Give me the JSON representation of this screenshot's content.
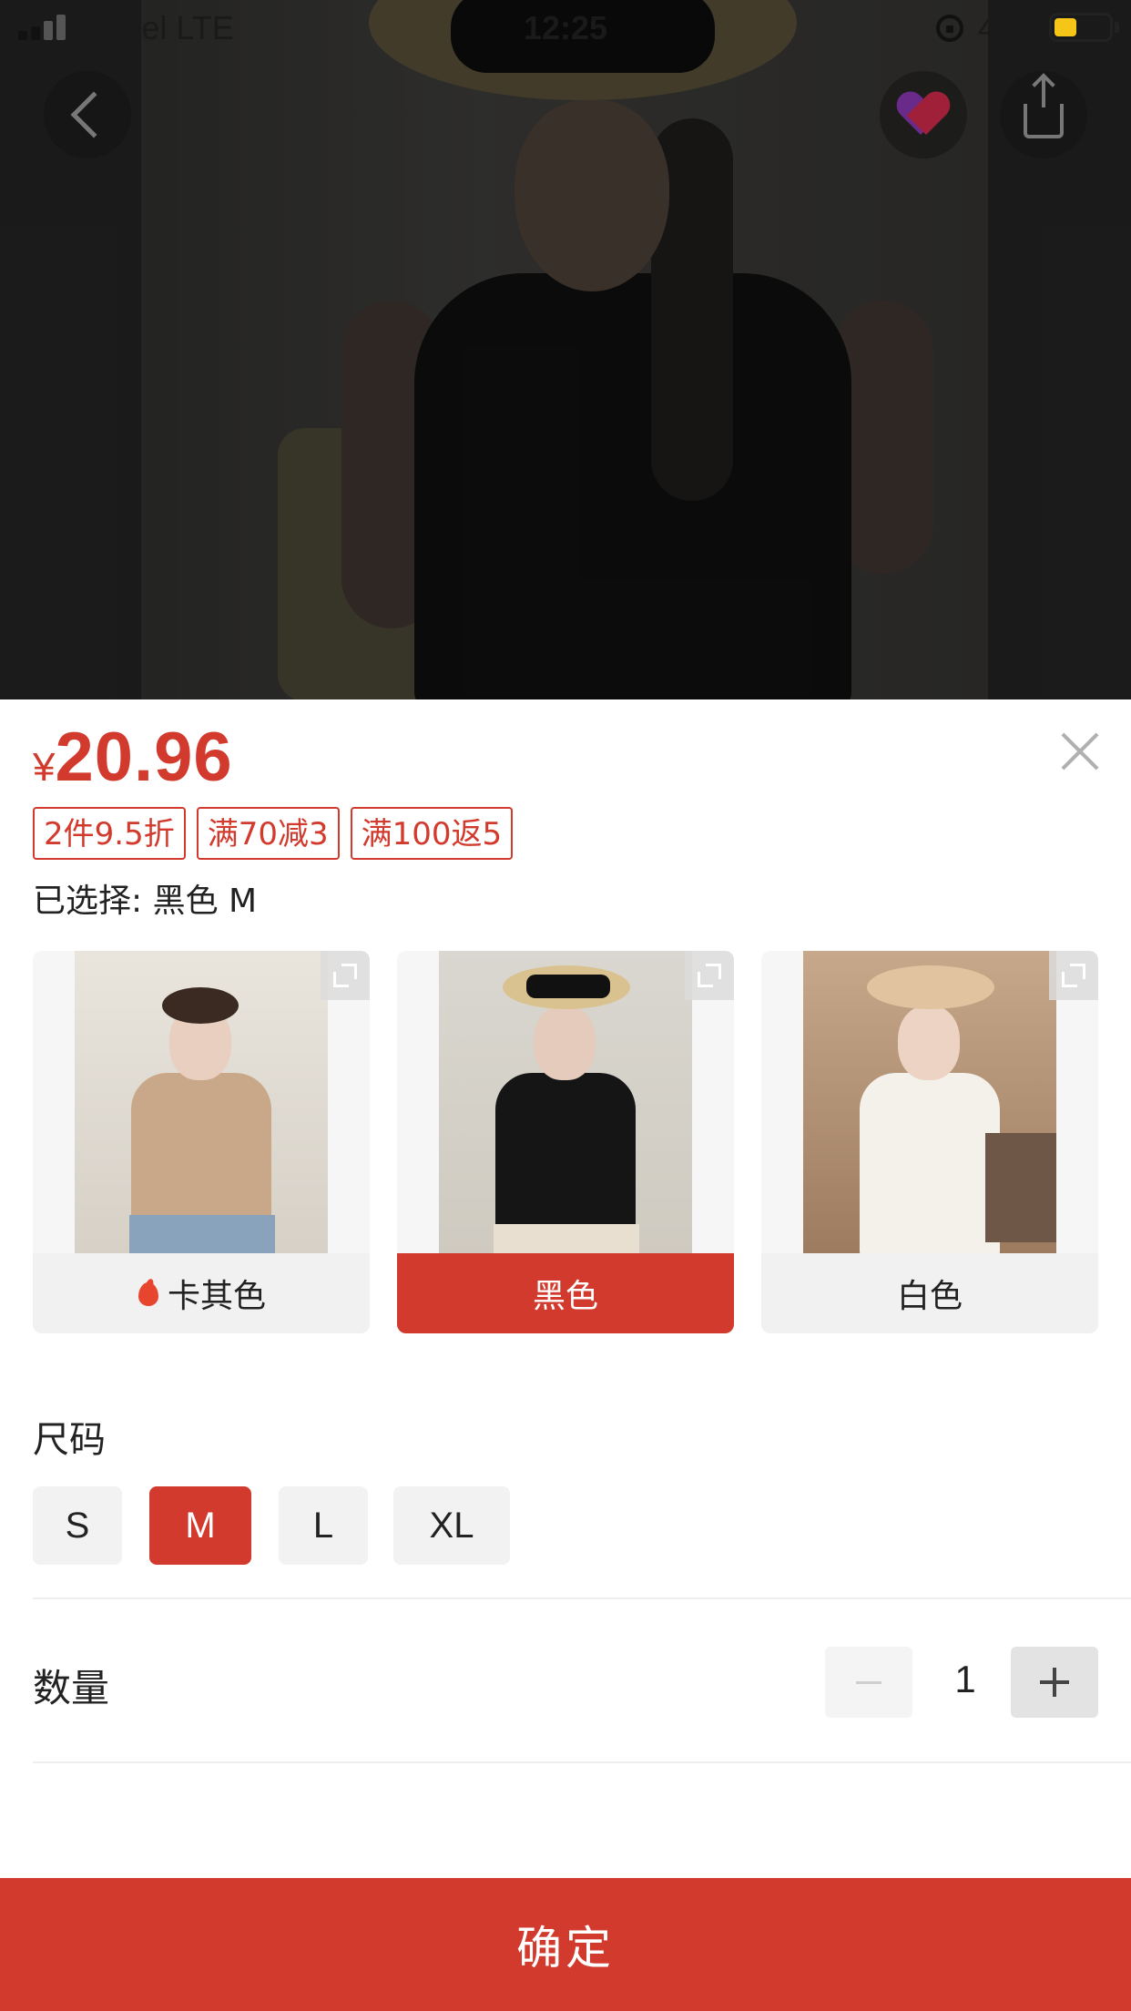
{
  "status_bar": {
    "carrier": "Viettel  LTE",
    "time": "12:25",
    "battery": "41%",
    "battery_level": 0.41
  },
  "product": {
    "currency_symbol": "¥",
    "price": "20.96",
    "promo_tags": [
      "2件9.5折",
      "满70减3",
      "满100返5"
    ],
    "selected_text": "已选择: 黑色 M"
  },
  "colors": [
    {
      "label": "卡其色",
      "hot": true,
      "active": false,
      "icon": "flame-icon"
    },
    {
      "label": "黑色",
      "hot": false,
      "active": true
    },
    {
      "label": "白色",
      "hot": false,
      "active": false
    }
  ],
  "size": {
    "title": "尺码",
    "options": [
      "S",
      "M",
      "L",
      "XL"
    ],
    "selected": "M"
  },
  "quantity": {
    "title": "数量",
    "value": "1"
  },
  "confirm_label": "确定",
  "theme": {
    "accent": "#d13a2c",
    "battery_color": "#f5c518"
  }
}
